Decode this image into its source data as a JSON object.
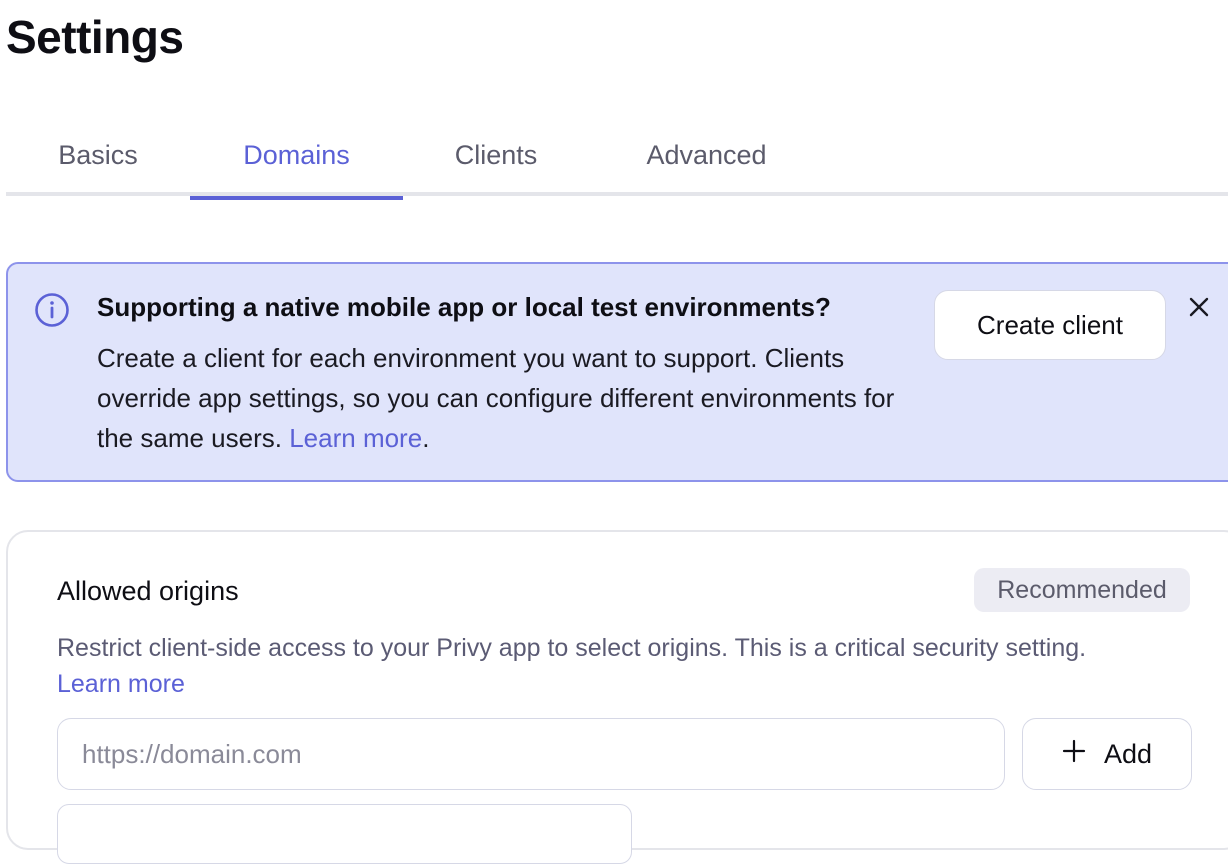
{
  "page": {
    "title": "Settings"
  },
  "tabs": [
    {
      "label": "Basics",
      "active": false
    },
    {
      "label": "Domains",
      "active": true
    },
    {
      "label": "Clients",
      "active": false
    },
    {
      "label": "Advanced",
      "active": false
    }
  ],
  "banner": {
    "icon": "info-icon",
    "title": "Supporting a native mobile app or local test environments?",
    "body": "Create a client for each environment you want to support. Clients override app settings, so you can configure different environments for the same users.",
    "link_label": "Learn more",
    "link_suffix": ".",
    "action_label": "Create client",
    "close_icon": "close-icon"
  },
  "allowed_origins": {
    "title": "Allowed origins",
    "badge": "Recommended",
    "description": "Restrict client-side access to your Privy app to select origins. This is a critical security setting.",
    "link_label": "Learn more",
    "input_placeholder": "https://domain.com",
    "input_value": "",
    "add_label": "Add",
    "add_icon": "plus-icon"
  },
  "colors": {
    "accent": "#5b61d6",
    "banner_bg": "#e0e4fb",
    "banner_border": "#8d93eb",
    "muted_text": "#5b5b74"
  }
}
